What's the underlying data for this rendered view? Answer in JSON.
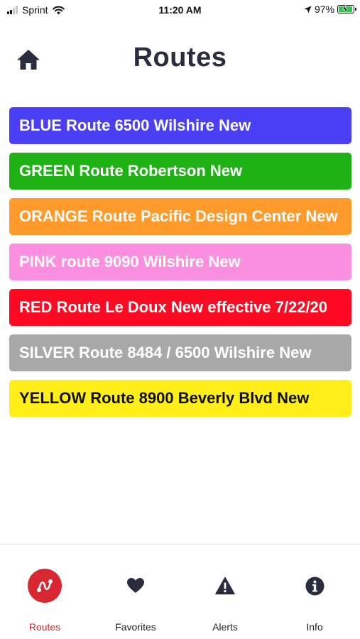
{
  "status_bar": {
    "carrier": "Sprint",
    "time": "11:20 AM",
    "battery_percent": "97%",
    "battery_level": 0.97,
    "icons": [
      "signal-icon",
      "wifi-icon",
      "location-arrow-icon",
      "battery-charging-icon"
    ]
  },
  "header": {
    "title": "Routes",
    "home_icon": "home-icon"
  },
  "routes": [
    {
      "label": "BLUE Route 6500 Wilshire New",
      "color": "#4a3ff5",
      "text_color": "#ffffff"
    },
    {
      "label": "GREEN Route Robertson New",
      "color": "#1fb214",
      "text_color": "#ffffff"
    },
    {
      "label": "ORANGE Route Pacific Design Center New",
      "color": "#ff9a2b",
      "text_color": "#ffffff"
    },
    {
      "label": "PINK route 9090 Wilshire New",
      "color": "#fb8fe0",
      "text_color": "#ffffff"
    },
    {
      "label": "RED Route Le Doux New effective 7/22/20",
      "color": "#ff0a22",
      "text_color": "#ffffff"
    },
    {
      "label": "SILVER Route 8484 / 6500 Wilshire New",
      "color": "#a8a8a8",
      "text_color": "#ffffff"
    },
    {
      "label": "YELLOW Route 8900 Beverly Blvd New",
      "color": "#ffee18",
      "text_color": "#111111"
    }
  ],
  "tabs": [
    {
      "label": "Routes",
      "icon": "route-icon",
      "active": true
    },
    {
      "label": "Favorites",
      "icon": "heart-icon",
      "active": false
    },
    {
      "label": "Alerts",
      "icon": "alert-triangle-icon",
      "active": false
    },
    {
      "label": "Info",
      "icon": "info-icon",
      "active": false
    }
  ],
  "colors": {
    "accent": "#d92732",
    "title": "#2a2d3e"
  }
}
